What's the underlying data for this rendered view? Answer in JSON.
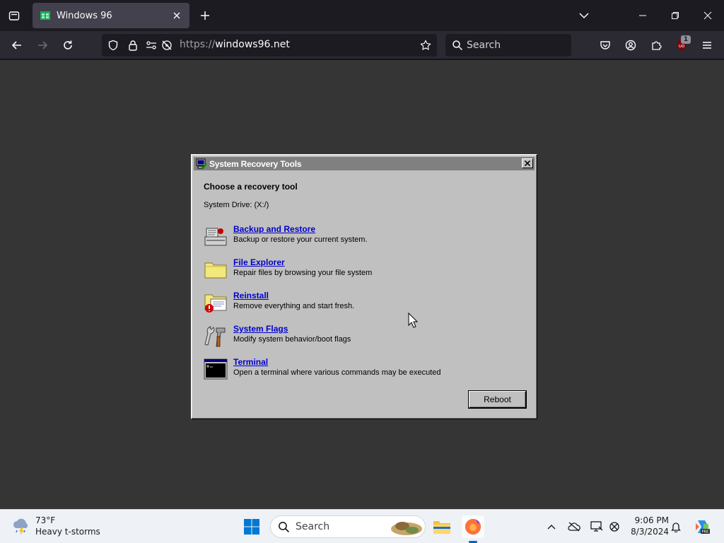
{
  "browser": {
    "tab": {
      "title": "Windows 96"
    },
    "url": {
      "scheme": "https://",
      "host": "windows96.net"
    },
    "search_placeholder": "Search",
    "extension_badge": "1"
  },
  "dialog": {
    "title": "System Recovery Tools",
    "heading": "Choose a recovery tool",
    "drive": "System Drive: (X:/)",
    "tools": [
      {
        "label": "Backup and Restore",
        "desc": "Backup or restore your current system."
      },
      {
        "label": "File Explorer",
        "desc": "Repair files by browsing your file system"
      },
      {
        "label": "Reinstall",
        "desc": "Remove everything and start fresh."
      },
      {
        "label": "System Flags",
        "desc": "Modify system behavior/boot flags"
      },
      {
        "label": "Terminal",
        "desc": "Open a terminal where various commands may be executed"
      }
    ],
    "reboot_label": "Reboot"
  },
  "taskbar": {
    "weather": {
      "temp": "73°F",
      "desc": "Heavy t-storms"
    },
    "search_placeholder": "Search",
    "clock": {
      "time": "9:06 PM",
      "date": "8/3/2024"
    }
  },
  "colors": {
    "link": "#0000cc",
    "dialog_bg": "#c0c0c0",
    "titlebar": "#808080",
    "page_bg": "#353535"
  }
}
